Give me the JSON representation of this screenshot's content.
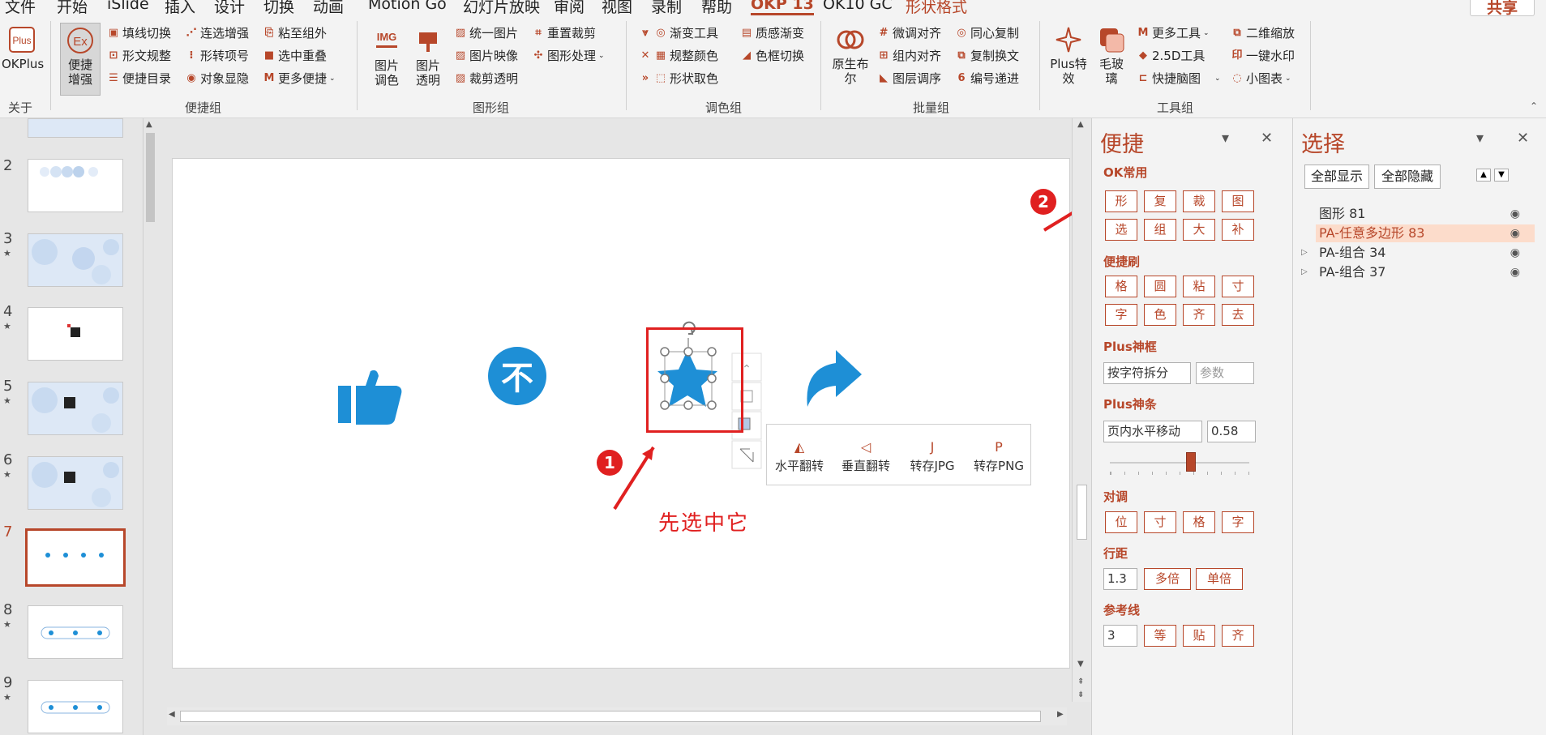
{
  "menu": {
    "items": [
      "文件",
      "开始",
      "iSlide",
      "插入",
      "设计",
      "切换",
      "动画",
      "Motion Go",
      "幻灯片放映",
      "审阅",
      "视图",
      "录制",
      "帮助",
      "OKP 13",
      "OK10 GC",
      "形状格式"
    ],
    "share": "共享"
  },
  "ribbon": {
    "about": {
      "okplus": "OKPlus",
      "label": "关于"
    },
    "bianjie_group": {
      "big": "便捷\n增强",
      "col1": [
        "填线切换",
        "形文规整",
        "便捷目录"
      ],
      "col2": [
        "连选增强",
        "形转项号",
        "对象显隐"
      ],
      "col3": [
        "粘至组外",
        "选中重叠",
        "更多便捷"
      ],
      "label": "便捷组"
    },
    "tuxing_group": {
      "big1": "图片\n调色",
      "big2": "图片\n透明",
      "col1": [
        "统一图片",
        "图片映像",
        "裁剪透明"
      ],
      "col2": [
        "重置裁剪",
        "图形处理"
      ],
      "label": "图形组"
    },
    "tiaose_group": {
      "col1": [
        "渐变工具",
        "规整颜色",
        "形状取色"
      ],
      "col2": [
        "质感渐变",
        "色框切换"
      ],
      "label": "调色组"
    },
    "piliang_group": {
      "big": "原生布\n尔",
      "col1": [
        "微调对齐",
        "组内对齐",
        "图层调序"
      ],
      "col2": [
        "同心复制",
        "复制换文",
        "编号递进"
      ],
      "label": "批量组"
    },
    "gongju_group": {
      "big1": "Plus特\n效",
      "big2": "毛玻\n璃",
      "col1": [
        "更多工具",
        "2.5D工具",
        "快捷脑图"
      ],
      "col2": [
        "二维缩放",
        "一键水印",
        "小图表"
      ],
      "label": "工具组"
    }
  },
  "thumbnails": [
    {
      "num": "2",
      "star": false
    },
    {
      "num": "3",
      "star": true
    },
    {
      "num": "4",
      "star": true
    },
    {
      "num": "5",
      "star": true
    },
    {
      "num": "6",
      "star": true
    },
    {
      "num": "7",
      "star": false
    },
    {
      "num": "8",
      "star": true
    },
    {
      "num": "9",
      "star": true
    }
  ],
  "slide": {
    "float_buttons": [
      "水平翻转",
      "垂直翻转",
      "转存JPG",
      "转存PNG"
    ],
    "annotation_text": "先选中它",
    "anno1": "1",
    "anno2": "2"
  },
  "pane_bianjie": {
    "title": "便捷",
    "sec_ok": "OK常用",
    "ok_row1": [
      "形",
      "复",
      "裁",
      "图"
    ],
    "ok_row2": [
      "选",
      "组",
      "大",
      "补"
    ],
    "sec_brush": "便捷刷",
    "brush_row1": [
      "格",
      "圆",
      "粘",
      "寸"
    ],
    "brush_row2": [
      "字",
      "色",
      "齐",
      "去"
    ],
    "sec_frame": "Plus神框",
    "frame_input": "按字符拆分",
    "frame_param": "参数",
    "sec_bar": "Plus神条",
    "bar_input": "页内水平移动",
    "bar_value": "0.58",
    "slider_value": 0.58,
    "sec_align": "对调",
    "align_row": [
      "位",
      "寸",
      "格",
      "字"
    ],
    "sec_spacing": "行距",
    "spacing_value": "1.3",
    "spacing_btn1": "多倍",
    "spacing_btn2": "单倍",
    "sec_guide": "参考线",
    "guide_value": "3",
    "guide_btns": [
      "等",
      "贴",
      "齐"
    ]
  },
  "pane_xuanze": {
    "title": "选择",
    "show_all": "全部显示",
    "hide_all": "全部隐藏",
    "layers": [
      {
        "name": "图形 81",
        "highlight": false,
        "group": false
      },
      {
        "name": "PA-任意多边形 83",
        "highlight": true,
        "group": false
      },
      {
        "name": "PA-组合 34",
        "highlight": false,
        "group": true
      },
      {
        "name": "PA-组合 37",
        "highlight": false,
        "group": true
      }
    ]
  },
  "colors": {
    "accent": "#b7472a",
    "icon_blue": "#1e8fd6",
    "annotation": "#e02020"
  }
}
